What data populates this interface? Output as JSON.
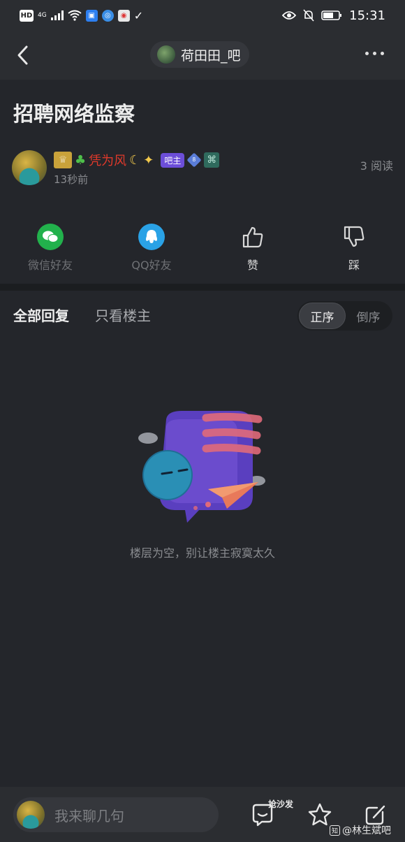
{
  "status_bar": {
    "left_indicators": [
      "HD",
      "4G"
    ],
    "time": "15:31"
  },
  "nav": {
    "forum_name": "荷田田_吧"
  },
  "post": {
    "title": "招聘网络监察",
    "author": {
      "name": "凭为风",
      "role_badge": "吧主",
      "level": "8",
      "time": "13秒前"
    },
    "read_count": "3 阅读"
  },
  "share": {
    "wechat_label": "微信好友",
    "qq_label": "QQ好友",
    "like_label": "赞",
    "dislike_label": "踩"
  },
  "replies": {
    "tab_all": "全部回复",
    "tab_op_only": "只看楼主",
    "order_asc": "正序",
    "order_desc": "倒序",
    "empty_message": "楼层为空，别让楼主寂寞太久"
  },
  "bottom_bar": {
    "input_placeholder": "我来聊几句",
    "sofa_label": "抢沙发",
    "watermark": "@林生斌吧"
  },
  "colors": {
    "background": "#24262b",
    "bar": "#2b2d31",
    "author_name": "#e0392b",
    "role_badge": "#6c4ed8",
    "wechat_green": "#22b14c",
    "qq_blue": "#2aa2e6"
  }
}
